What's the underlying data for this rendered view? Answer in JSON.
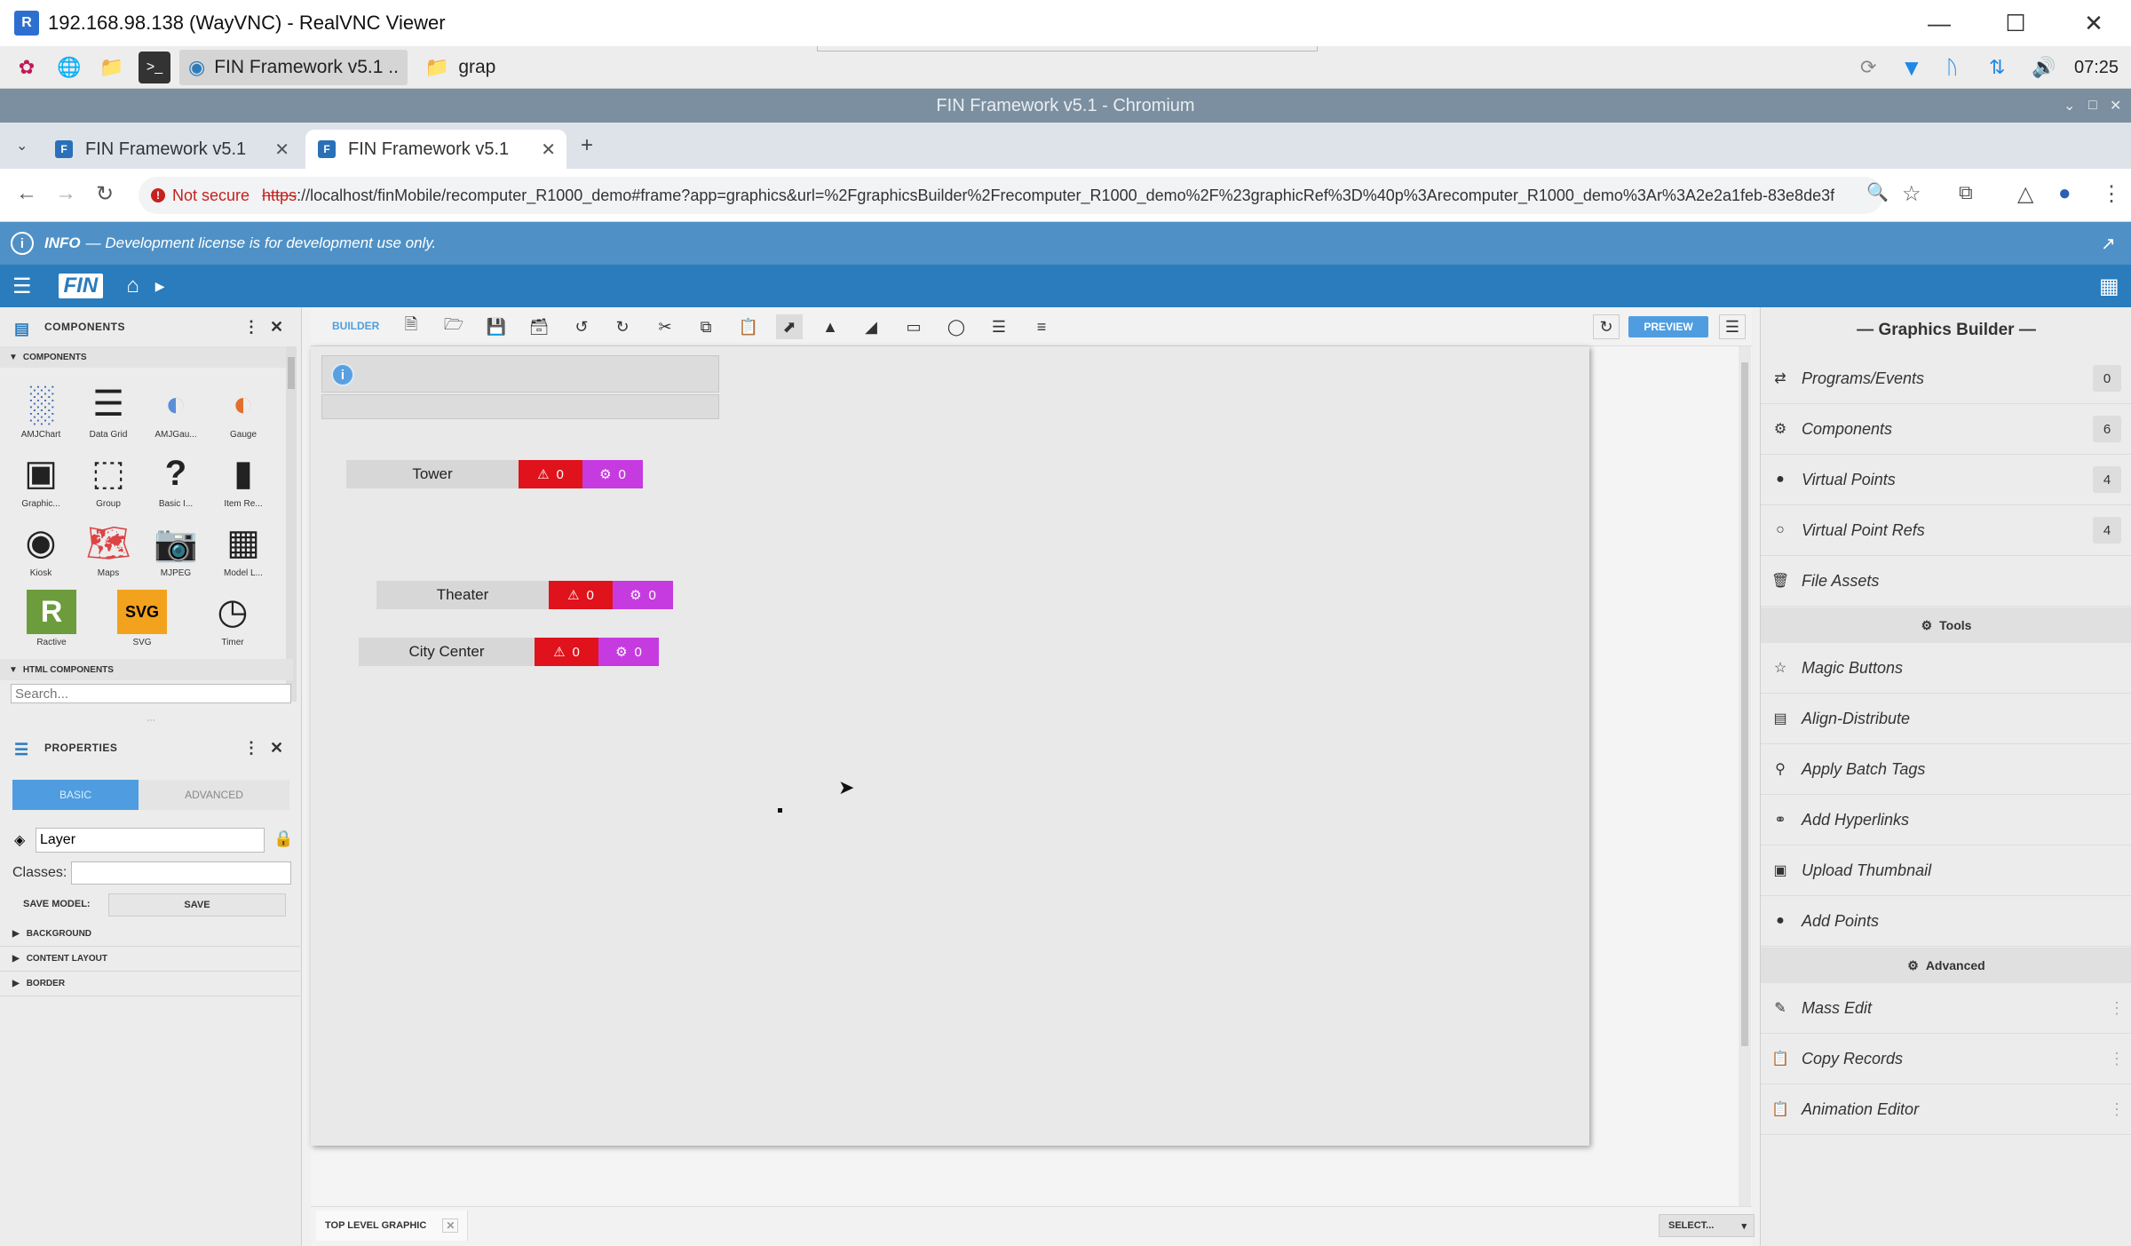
{
  "vnc": {
    "title": "192.168.98.138 (WayVNC) - RealVNC Viewer",
    "icon": "realvnc-logo-icon"
  },
  "taskbar": {
    "tasks": [
      {
        "label": "FIN Framework v5.1 ..",
        "icon": "chromium-icon"
      },
      {
        "label": "grap",
        "icon": "folder-icon"
      }
    ],
    "time": "07:25"
  },
  "chrome": {
    "window_title": "FIN Framework v5.1 - Chromium"
  },
  "tabs": [
    {
      "label": "FIN Framework v5.1"
    },
    {
      "label": "FIN Framework v5.1"
    }
  ],
  "address": {
    "not_secure": "Not secure",
    "url_scheme": "https",
    "url_rest": "://localhost/finMobile/recomputer_R1000_demo#frame?app=graphics&url=%2FgraphicsBuilder%2Frecomputer_R1000_demo%2F%23graphicRef%3D%40p%3Arecomputer_R1000_demo%3Ar%3A2e2a1feb-83e8de3f"
  },
  "info": {
    "label": "INFO",
    "message": "— Development license is for development use only."
  },
  "finnav": {
    "logo": "FIN"
  },
  "components_panel": {
    "title": "COMPONENTS",
    "section": "COMPONENTS",
    "items": [
      {
        "label": "AMJChart",
        "icon": "chart-icon"
      },
      {
        "label": "Data Grid",
        "icon": "grid-icon"
      },
      {
        "label": "AMJGau...",
        "icon": "gauge-icon"
      },
      {
        "label": "Gauge",
        "icon": "gauge-color-icon"
      },
      {
        "label": "Graphic...",
        "icon": "graphic-icon"
      },
      {
        "label": "Group",
        "icon": "group-icon"
      },
      {
        "label": "Basic I...",
        "icon": "question-icon"
      },
      {
        "label": "Item Re...",
        "icon": "item-repeater-icon"
      },
      {
        "label": "Kiosk",
        "icon": "kiosk-icon"
      },
      {
        "label": "Maps",
        "icon": "maps-icon"
      },
      {
        "label": "MJPEG",
        "icon": "camera-icon"
      },
      {
        "label": "Model L...",
        "icon": "model-layout-icon"
      },
      {
        "label": "Ractive",
        "icon": "ractive-icon"
      },
      {
        "label": "SVG",
        "icon": "svg-icon"
      },
      {
        "label": "Timer",
        "icon": "clock-icon"
      }
    ],
    "html_section": "HTML COMPONENTS",
    "search_placeholder": "Search..."
  },
  "properties_panel": {
    "title": "PROPERTIES",
    "tab_basic": "BASIC",
    "tab_advanced": "ADVANCED",
    "layer_value": "Layer",
    "classes_label": "Classes:",
    "save_model_label": "SAVE MODEL:",
    "save_button": "SAVE",
    "sections": [
      "BACKGROUND",
      "CONTENT LAYOUT",
      "BORDER"
    ]
  },
  "builder": {
    "label": "BUILDER",
    "preview": "PREVIEW"
  },
  "canvas": {
    "sites": [
      {
        "name": "Tower",
        "alarms": "0",
        "configs": "0"
      },
      {
        "name": "Theater",
        "alarms": "0",
        "configs": "0"
      },
      {
        "name": "City Center",
        "alarms": "0",
        "configs": "0"
      }
    ]
  },
  "bottom": {
    "tab_label": "TOP LEVEL GRAPHIC",
    "select_label": "SELECT..."
  },
  "graphics_builder": {
    "title": "— Graphics Builder —",
    "items": [
      {
        "label": "Programs/Events",
        "icon": "shuffle-icon",
        "badge": "0"
      },
      {
        "label": "Components",
        "icon": "gear-icon",
        "badge": "6"
      },
      {
        "label": "Virtual Points",
        "icon": "pin-icon",
        "badge": "4"
      },
      {
        "label": "Virtual Point Refs",
        "icon": "pin-outline-icon",
        "badge": "4"
      },
      {
        "label": "File Assets",
        "icon": "trash-icon"
      }
    ],
    "tools_label": "Tools",
    "tools": [
      {
        "label": "Magic Buttons",
        "icon": "star-icon"
      },
      {
        "label": "Align-Distribute",
        "icon": "align-icon"
      },
      {
        "label": "Apply Batch Tags",
        "icon": "tag-icon"
      },
      {
        "label": "Add Hyperlinks",
        "icon": "link-icon"
      },
      {
        "label": "Upload Thumbnail",
        "icon": "image-icon"
      },
      {
        "label": "Add Points",
        "icon": "pin-icon"
      }
    ],
    "advanced_label": "Advanced",
    "advanced": [
      {
        "label": "Mass Edit",
        "icon": "edit-icon"
      },
      {
        "label": "Copy Records",
        "icon": "clipboard-icon"
      },
      {
        "label": "Animation Editor",
        "icon": "clipboard-icon"
      }
    ]
  }
}
